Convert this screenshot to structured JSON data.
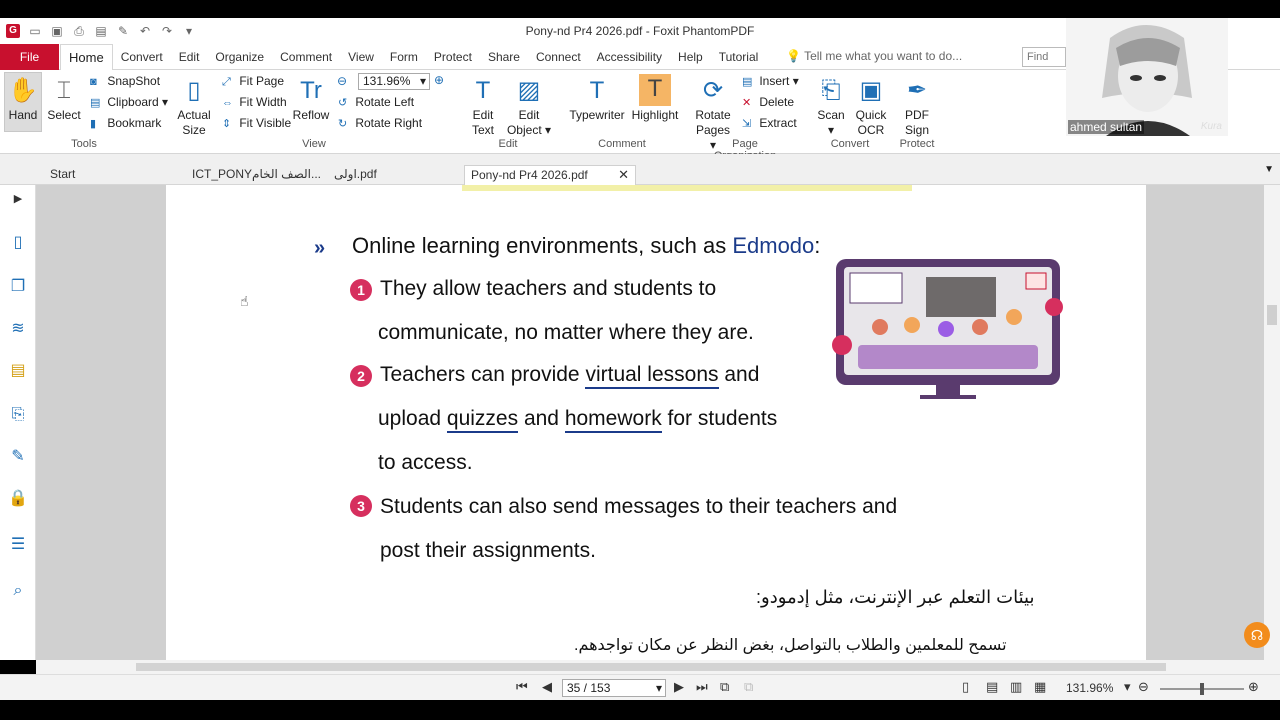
{
  "window": {
    "title": "Pony-nd Pr4 2026.pdf - Foxit PhantomPDF",
    "logo": "G"
  },
  "menu": {
    "file": "File",
    "tabs": [
      "Home",
      "Convert",
      "Edit",
      "Organize",
      "Comment",
      "View",
      "Form",
      "Protect",
      "Share",
      "Connect",
      "Accessibility",
      "Help",
      "Tutorial"
    ],
    "tell_me": "Tell me what you want to do...",
    "find_placeholder": "Find"
  },
  "ribbon": {
    "tools": {
      "hand": "Hand",
      "select": "Select",
      "snapshot": "SnapShot",
      "clipboard": "Clipboard",
      "bookmark": "Bookmark",
      "group": "Tools"
    },
    "view": {
      "actual_size_1": "Actual",
      "actual_size_2": "Size",
      "fit_page": "Fit Page",
      "fit_width": "Fit Width",
      "fit_visible": "Fit Visible",
      "reflow": "Reflow",
      "zoom": "131.96%",
      "rotate_left": "Rotate Left",
      "rotate_right": "Rotate Right",
      "group": "View"
    },
    "edit": {
      "edit_text_1": "Edit",
      "edit_text_2": "Text",
      "edit_object_1": "Edit",
      "edit_object_2": "Object",
      "group": "Edit"
    },
    "comment": {
      "typewriter": "Typewriter",
      "highlight": "Highlight",
      "group": "Comment"
    },
    "page_org": {
      "rotate_pages_1": "Rotate",
      "rotate_pages_2": "Pages",
      "insert": "Insert",
      "delete": "Delete",
      "extract": "Extract",
      "group": "Page Organization"
    },
    "convert": {
      "scan": "Scan",
      "quick_ocr_1": "Quick",
      "quick_ocr_2": "OCR",
      "group": "Convert"
    },
    "protect": {
      "pdf_sign_1": "PDF",
      "pdf_sign_2": "Sign",
      "group": "Protect"
    }
  },
  "tabs": {
    "start": "Start",
    "tab2": "ICT_PONYالصف الخام...",
    "tab3": "اولى.pdf",
    "tab4": "Pony-nd Pr4 2026.pdf"
  },
  "pdf": {
    "heading_pre": "Online learning environments, such as ",
    "heading_brand": "Edmodo",
    "heading_post": ":",
    "n1": "1",
    "n2": "2",
    "n3": "3",
    "line1": "They allow teachers and students to",
    "line2": "communicate, no matter where they are.",
    "line3_a": "Teachers can provide ",
    "line3_b": "virtual lessons",
    "line3_c": " and",
    "line4_a": "upload ",
    "line4_b": "quizzes",
    "line4_c": " and ",
    "line4_d": "homework",
    "line4_e": " for students",
    "line5": "to access.",
    "line6": "Students can also send messages to their teachers and",
    "line7": "post their assignments.",
    "ar_heading": "بيئات التعلم عبر الإنترنت، مثل إدمودو:",
    "ar_line": "تسمح للمعلمين والطلاب بالتواصل، بغض النظر عن مكان تواجدهم."
  },
  "status": {
    "page": "35 / 153",
    "zoom": "131.96%"
  },
  "webcam": {
    "name": "ahmed sultan",
    "signature": "Kura"
  },
  "colors": {
    "brand_red": "#c8102e",
    "accent_blue": "#1f6fb5",
    "number_pink": "#d62f5e"
  }
}
